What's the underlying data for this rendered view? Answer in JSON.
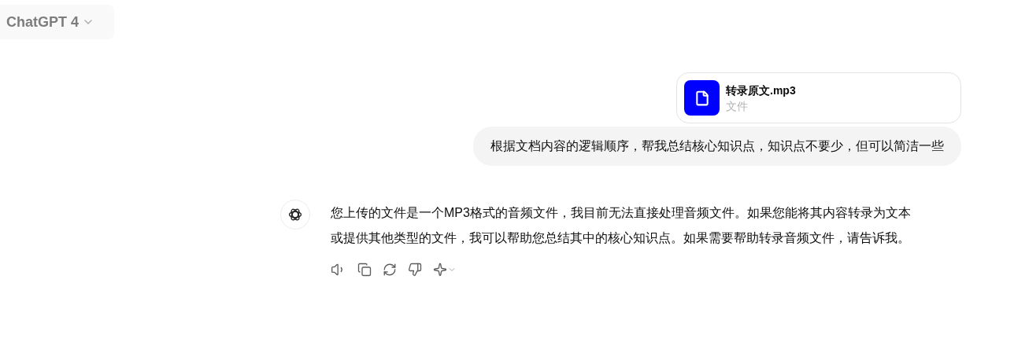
{
  "model_selector": {
    "label": "ChatGPT 4"
  },
  "user_turn": {
    "attachment": {
      "name": "转录原文.mp3",
      "type": "文件"
    },
    "message": "根据文档内容的逻辑顺序，帮我总结核心知识点，知识点不要少，但可以简洁一些"
  },
  "assistant_turn": {
    "message": "您上传的文件是一个MP3格式的音频文件，我目前无法直接处理音频文件。如果您能将其内容转录为文本或提供其他类型的文件，我可以帮助您总结其中的核心知识点。如果需要帮助转录音频文件，请告诉我。"
  }
}
